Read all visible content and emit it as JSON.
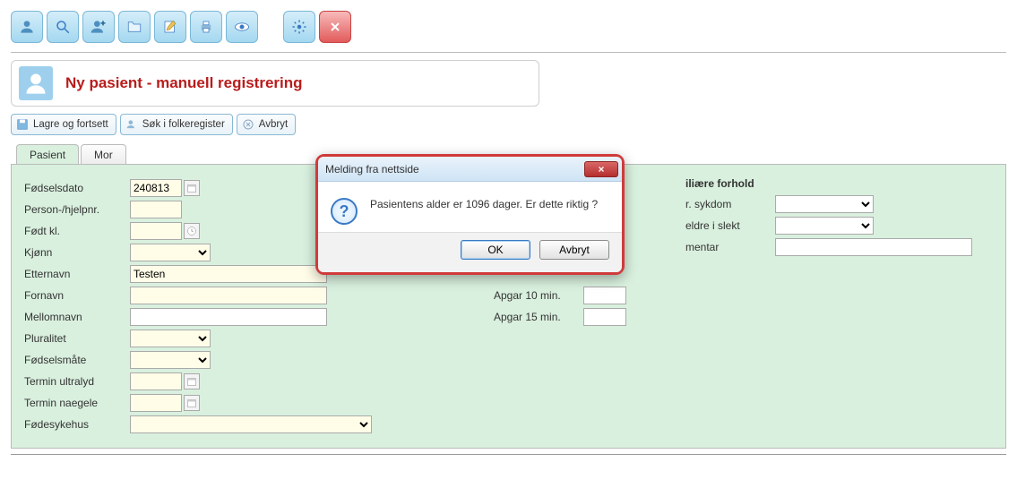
{
  "page": {
    "title": "Ny pasient - manuell registrering"
  },
  "actions": {
    "save_continue": "Lagre og fortsett",
    "folk_search": "Søk i folkeregister",
    "cancel": "Avbryt"
  },
  "tabs": {
    "patient": "Pasient",
    "mother": "Mor"
  },
  "form": {
    "labels": {
      "fodselsdato": "Fødselsdato",
      "personnr": "Person-/hjelpnr.",
      "fodt_kl": "Født kl.",
      "kjonn": "Kjønn",
      "etternavn": "Etternavn",
      "fornavn": "Fornavn",
      "mellomnavn": "Mellomnavn",
      "pluralitet": "Pluralitet",
      "fodselsmate": "Fødselsmåte",
      "termin_ul": "Termin ultralyd",
      "termin_naegele": "Termin naegele",
      "fodesykehus": "Fødesykehus",
      "apgar10": "Apgar 10 min.",
      "apgar15": "Apgar 15 min."
    },
    "values": {
      "fodselsdato": "240813",
      "personnr": "",
      "fodt_kl": "",
      "kjonn": "",
      "etternavn": "Testen",
      "fornavn": "",
      "mellomnavn": "",
      "pluralitet": "",
      "fodselsmate": "",
      "termin_ul": "",
      "termin_naegele": "",
      "fodesykehus": "",
      "apgar10": "",
      "apgar15": ""
    }
  },
  "family_section": {
    "header_fragment": "iliære forhold",
    "sykdom_label_fragment": "r. sykdom",
    "eldre_label_fragment": "eldre i slekt",
    "mentar_label_fragment": "mentar"
  },
  "dialog": {
    "title": "Melding fra nettside",
    "message": "Pasientens alder er 1096 dager. Er dette riktig ?",
    "ok": "OK",
    "cancel": "Avbryt"
  }
}
